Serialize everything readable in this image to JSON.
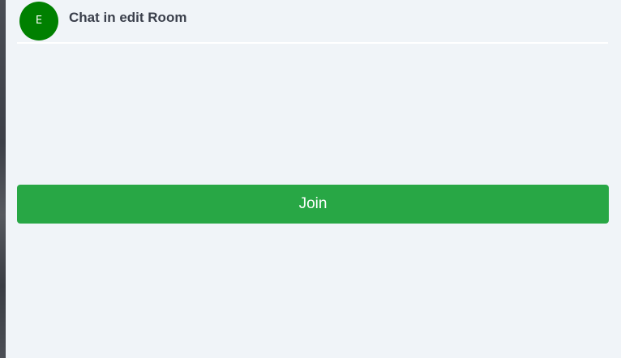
{
  "header": {
    "avatar_initial": "E",
    "avatar_color": "#008000",
    "title": "Chat in edit Room"
  },
  "actions": {
    "join_label": "Join",
    "join_color": "#28a745"
  }
}
